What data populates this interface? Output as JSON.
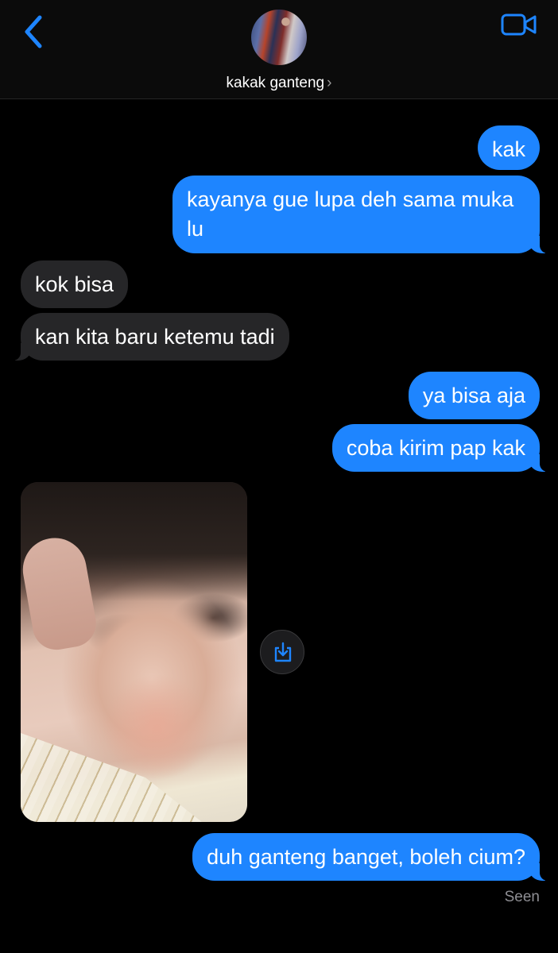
{
  "header": {
    "contact_name": "kakak ganteng",
    "chevron": "›",
    "back_icon": "chevron-left-icon",
    "video_icon": "video-camera-icon",
    "accent": "#1e85ff"
  },
  "messages": [
    {
      "direction": "outgoing",
      "text": "kak"
    },
    {
      "direction": "outgoing",
      "text": "kayanya gue lupa deh sama muka lu"
    },
    {
      "direction": "incoming",
      "text": "kok bisa"
    },
    {
      "direction": "incoming",
      "text": "kan kita baru ketemu tadi"
    },
    {
      "direction": "outgoing",
      "text": "ya bisa aja"
    },
    {
      "direction": "outgoing",
      "text": "coba kirim pap kak"
    },
    {
      "direction": "incoming",
      "type": "photo"
    },
    {
      "direction": "outgoing",
      "text": "duh ganteng banget, boleh cium?"
    }
  ],
  "status": {
    "seen": "Seen"
  },
  "colors": {
    "outgoing_bubble": "#1e85ff",
    "incoming_bubble": "#262628",
    "background": "#000000"
  }
}
